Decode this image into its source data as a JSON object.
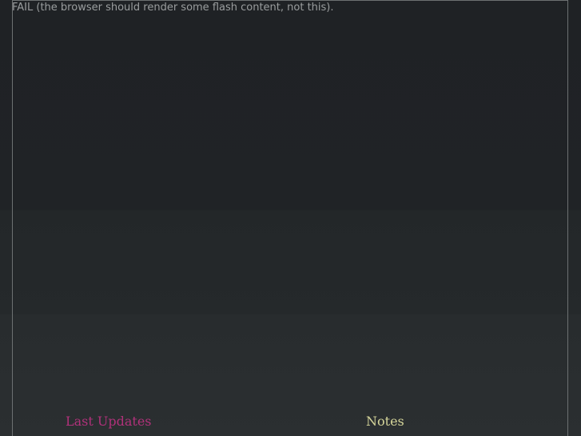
{
  "plugin": {
    "fallback_text": "FAIL (the browser should render some flash content, not this)."
  },
  "sections": {
    "updates_title": "Last Updates",
    "notes_title": "Notes"
  },
  "colors": {
    "background": "#1f2225",
    "frame_border": "#6d7172",
    "fallback_text": "#9a9d9e",
    "updates_heading": "#b0317a",
    "notes_heading": "#d5d59a"
  }
}
